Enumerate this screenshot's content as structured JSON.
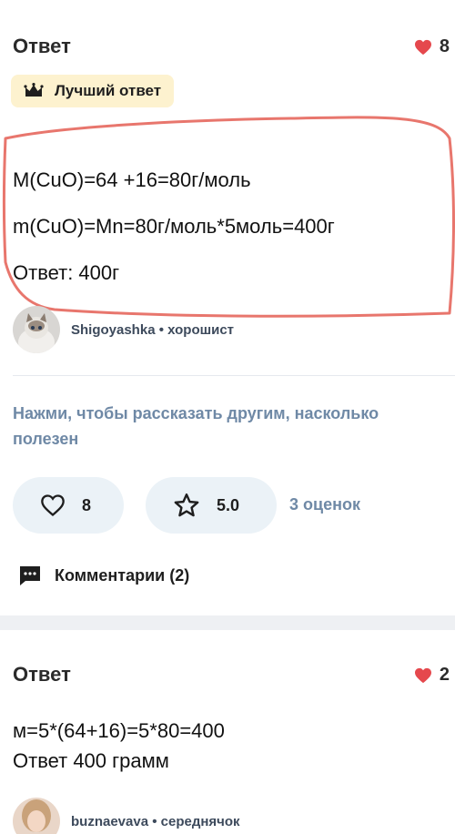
{
  "answers": [
    {
      "title": "Ответ",
      "likes": "8",
      "best_badge": "Лучший ответ",
      "lines": [
        "M(CuO)=64 +16=80г/моль",
        "m(CuO)=Mn=80г/моль*5моль=400г",
        "Ответ: 400г"
      ],
      "author": {
        "name": "Shigoyashka",
        "separator": "•",
        "rank": "хорошист"
      }
    },
    {
      "title": "Ответ",
      "likes": "2",
      "lines": [
        "м=5*(64+16)=5*80=400",
        "Ответ 400 грамм"
      ],
      "author": {
        "name": "buznaevava",
        "separator": "•",
        "rank": "середнячок"
      }
    }
  ],
  "feedback": {
    "prompt_line1": "Нажми, чтобы рассказать другим, насколько",
    "prompt_line2": "полезен",
    "like_count": "8",
    "rating": "5.0",
    "ratings_count": "3 оценок",
    "comments_label": "Комментарии (2)"
  },
  "colors": {
    "heart": "#e5484d",
    "highlight_circle": "#e8766d",
    "badge_bg": "#fdf2cf",
    "pill_bg": "#ebf2f7",
    "muted_blue": "#6f89a6"
  },
  "icons": [
    "heart-icon",
    "crown-icon",
    "heart-outline-icon",
    "star-outline-icon",
    "comment-icon"
  ]
}
